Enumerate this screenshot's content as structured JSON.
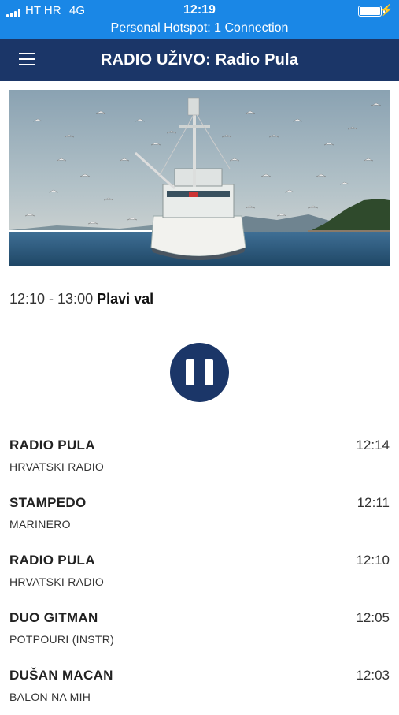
{
  "status_bar": {
    "carrier": "HT HR",
    "network": "4G",
    "time": "12:19",
    "hotspot": "Personal Hotspot: 1 Connection",
    "battery_level": 1.0
  },
  "header": {
    "title": "RADIO UŽIVO: Radio Pula",
    "menu_icon": "hamburger-menu-icon"
  },
  "hero": {
    "image_description_icon": "fishing-boat-image"
  },
  "now_playing": {
    "time_range": "12:10 - 13:00",
    "show_name": "Plavi val"
  },
  "player": {
    "state": "playing",
    "button_icon": "pause-icon"
  },
  "tracks": [
    {
      "artist": "RADIO PULA",
      "title": "HRVATSKI RADIO",
      "time": "12:14"
    },
    {
      "artist": "STAMPEDO",
      "title": "MARINERO",
      "time": "12:11"
    },
    {
      "artist": "RADIO PULA",
      "title": "HRVATSKI RADIO",
      "time": "12:10"
    },
    {
      "artist": "DUO GITMAN",
      "title": "POTPOURI (INSTR)",
      "time": "12:05"
    },
    {
      "artist": "DUŠAN MACAN",
      "title": "BALON NA MIH",
      "time": "12:03"
    }
  ],
  "colors": {
    "status_bar": "#1a87e6",
    "nav_bar": "#1b3668",
    "accent": "#1b3668"
  }
}
